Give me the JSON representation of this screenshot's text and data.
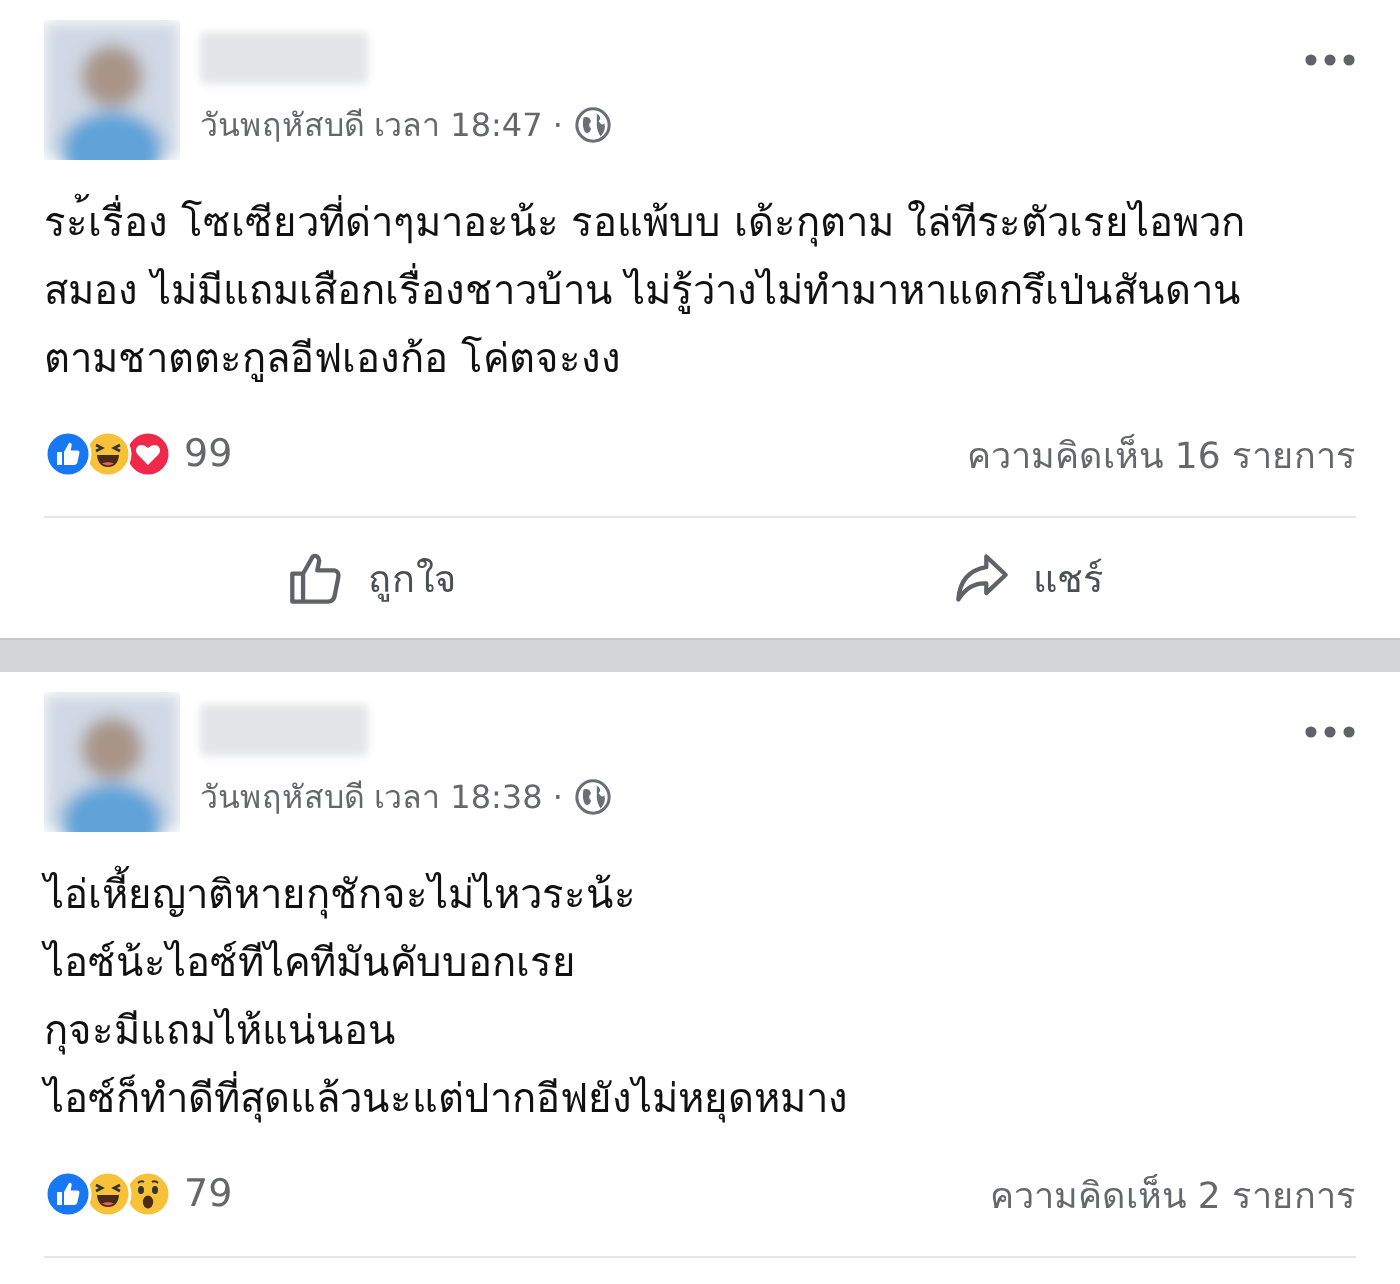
{
  "posts": [
    {
      "date": "วันพฤหัสบดี เวลา 18:47 ·",
      "lines": [
        "ระ้เรื่อง โซเซียวที่ด่าๆมาอะน้ะ รอแพ้บบ เด้ะกุตาม ใล่ทีระตัวเรยไอพวก",
        "สมอง ไม่มีแถมเสือกเรื่องชาวบ้าน ไม่รู้ว่างไม่ทำมาหาแดกรึเป่นสันดาน",
        "ตามชาตตะกูลอีฟเองก้อ โค่ตจะงง"
      ],
      "reactions": [
        {
          "kind": "like"
        },
        {
          "kind": "haha"
        },
        {
          "kind": "love"
        }
      ],
      "reaction_count": "99",
      "comments": "ความคิดเห็น 16 รายการ",
      "actions": [
        {
          "kind": "like",
          "label": "ถูกใจ"
        },
        {
          "kind": "share",
          "label": "แชร์"
        }
      ]
    },
    {
      "date": "วันพฤหัสบดี เวลา 18:38 ·",
      "lines": [
        "ไอ่เหี้ยญาติหายกุชักจะไม่ไหวระน้ะ",
        "ไอซ์น้ะไอซ์ทีไคทีมันคับบอกเรย",
        "กุจะมีแถมไห้แน่นอน",
        "ไอซ์ก็ทำดีที่สุดแล้วนะแต่ปากอีฟยังไม่หยุดหมาง"
      ],
      "reactions": [
        {
          "kind": "like"
        },
        {
          "kind": "haha"
        },
        {
          "kind": "wow"
        }
      ],
      "reaction_count": "79",
      "comments": "ความคิดเห็น 2 รายการ"
    }
  ]
}
